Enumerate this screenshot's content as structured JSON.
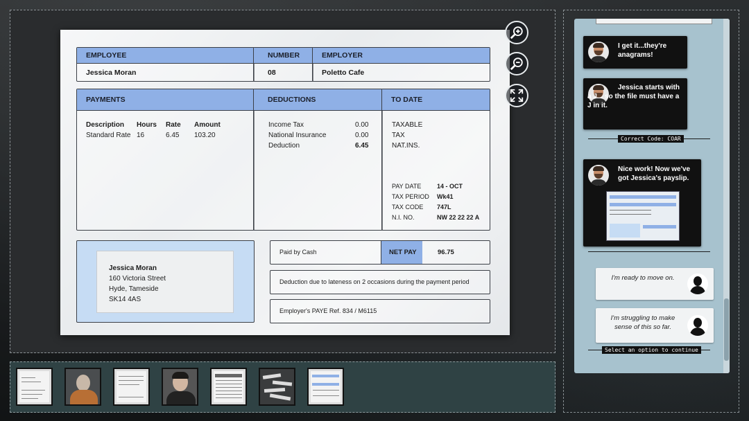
{
  "payslip": {
    "employee_header": "EMPLOYEE",
    "employee_name": "Jessica Moran",
    "number_header": "NUMBER",
    "number_value": "08",
    "employer_header": "EMPLOYER",
    "employer_value": "Poletto Cafe",
    "payments": {
      "header": "PAYMENTS",
      "columns": [
        "Description",
        "Hours",
        "Rate",
        "Amount"
      ],
      "row": [
        "Standard Rate",
        "16",
        "6.45",
        "103.20"
      ]
    },
    "deductions": {
      "header": "DEDUCTIONS",
      "rows": [
        {
          "label": "Income Tax",
          "value": "0.00"
        },
        {
          "label": "National Insurance",
          "value": "0.00"
        },
        {
          "label": "Deduction",
          "value": "6.45"
        }
      ]
    },
    "to_date": {
      "header": "TO DATE",
      "labels": [
        "TAXABLE",
        "TAX",
        "NAT.INS."
      ],
      "details": [
        {
          "label": "PAY DATE",
          "value": "14 - OCT"
        },
        {
          "label": "TAX PERIOD",
          "value": "Wk41"
        },
        {
          "label": "TAX CODE",
          "value": "747L"
        },
        {
          "label": "N.I. NO.",
          "value": "NW 22 22 22 A"
        }
      ]
    },
    "address": {
      "name": "Jessica Moran",
      "line1": "160 Victoria Street",
      "line2": "Hyde, Tameside",
      "line3": "SK14 4AS"
    },
    "paid_by": "Paid by Cash",
    "net_pay_label": "NET PAY",
    "net_pay_value": "96.75",
    "note": "Deduction due to lateness on 2 occasions during the payment period",
    "paye_ref": "Employer's PAYE Ref. 834 / M6115"
  },
  "tools": {
    "zoom_in": "zoom-in-icon",
    "zoom_out": "zoom-out-icon",
    "fullscreen": "fullscreen-icon"
  },
  "chat": {
    "messages": [
      {
        "text": "I get it...they're anagrams!"
      },
      {
        "text": "Jessica starts with a J... so the file must have a J in it."
      },
      {
        "text": "Nice work! Now we've got Jessica's payslip."
      }
    ],
    "correct_code_tag": "Correct Code: COAR",
    "options": [
      {
        "text": "I'm ready to move on."
      },
      {
        "text": "I'm struggling to make sense of this so far."
      }
    ],
    "select_tag": "Select an option to continue"
  },
  "colors": {
    "header_blue": "#8fb0e6",
    "panel_blue": "#a7c2ce",
    "address_panel": "#c6dcf4"
  }
}
